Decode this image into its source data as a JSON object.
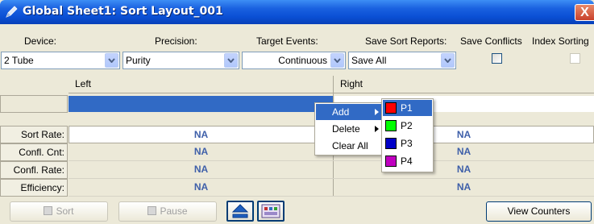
{
  "window": {
    "title": "Global Sheet1: Sort Layout_001",
    "close_label": "X",
    "icon": "pencil-icon"
  },
  "settings": {
    "device_label": "Device:",
    "precision_label": "Precision:",
    "target_events_label": "Target Events:",
    "save_reports_label": "Save Sort Reports:",
    "save_conflicts_label": "Save Conflicts",
    "index_sorting_label": "Index Sorting",
    "device_value": "2 Tube",
    "precision_value": "Purity",
    "target_events_value": "Continuous",
    "save_reports_value": "Save All",
    "save_conflicts_checked": false,
    "index_sorting_checked": false,
    "index_sorting_enabled": false
  },
  "grid": {
    "left_header": "Left",
    "right_header": "Right",
    "rows": [
      {
        "label": "Sort Rate:",
        "left": "NA",
        "right": "NA"
      },
      {
        "label": "Confl. Cnt:",
        "left": "NA",
        "right": "NA"
      },
      {
        "label": "Confl. Rate:",
        "left": "NA",
        "right": "NA"
      },
      {
        "label": "Efficiency:",
        "left": "NA",
        "right": "NA"
      }
    ]
  },
  "context_menu": {
    "items": [
      {
        "label": "Add",
        "has_submenu": true,
        "highlighted": true
      },
      {
        "label": "Delete",
        "has_submenu": true,
        "highlighted": false
      },
      {
        "label": "Clear All",
        "has_submenu": false,
        "highlighted": false
      }
    ],
    "submenu": [
      {
        "label": "P1",
        "color": "#ff0000",
        "highlighted": true
      },
      {
        "label": "P2",
        "color": "#00ff00",
        "highlighted": false
      },
      {
        "label": "P3",
        "color": "#0000c8",
        "highlighted": false
      },
      {
        "label": "P4",
        "color": "#c000c0",
        "highlighted": false
      }
    ]
  },
  "toolbar": {
    "sort_label": "Sort",
    "pause_label": "Pause",
    "eject_icon": "eject-icon",
    "tray_icon": "tray-icon",
    "view_counters_label": "View Counters"
  },
  "colors": {
    "title_bar": "#0a4fd4",
    "selection": "#316ac5",
    "na_text": "#3e5fa9"
  }
}
